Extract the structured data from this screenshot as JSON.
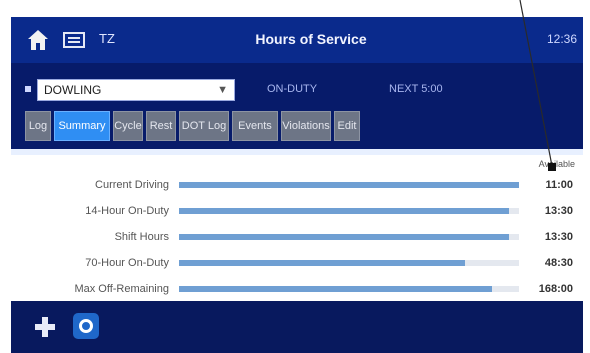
{
  "header": {
    "title": "Hours of Service",
    "ampm": "TZ",
    "clock": "12:36"
  },
  "filters": {
    "driver": "DOWLING",
    "status_a": "ON-DUTY",
    "status_b": "NEXT 5:00"
  },
  "tabs": [
    {
      "label": "Log",
      "active": false
    },
    {
      "label": "Summary",
      "active": true
    },
    {
      "label": "Cycle",
      "active": false
    },
    {
      "label": "Rest",
      "active": false
    },
    {
      "label": "DOT Log",
      "active": false
    },
    {
      "label": "Events",
      "active": false
    },
    {
      "label": "Violations",
      "active": false
    },
    {
      "label": "Edit",
      "active": false
    }
  ],
  "panel": {
    "column_header": "Available",
    "rows": [
      {
        "label": "Current Driving",
        "value": "11:00",
        "level": 1.0
      },
      {
        "label": "14-Hour On-Duty",
        "value": "13:30",
        "level": 0.97
      },
      {
        "label": "Shift Hours",
        "value": "13:30",
        "level": 0.97
      },
      {
        "label": "70-Hour On-Duty",
        "value": "48:30",
        "level": 0.84
      },
      {
        "label": "Max Off-Remaining",
        "value": "168:00",
        "level": 0.92
      }
    ]
  },
  "icons": {
    "home": "home-icon",
    "document": "document-icon",
    "add": "add-icon",
    "settings": "settings-icon"
  },
  "colors": {
    "background": "#071b6a",
    "accent": "#2f8ef3",
    "bar_fill": "#6f9fd3"
  }
}
